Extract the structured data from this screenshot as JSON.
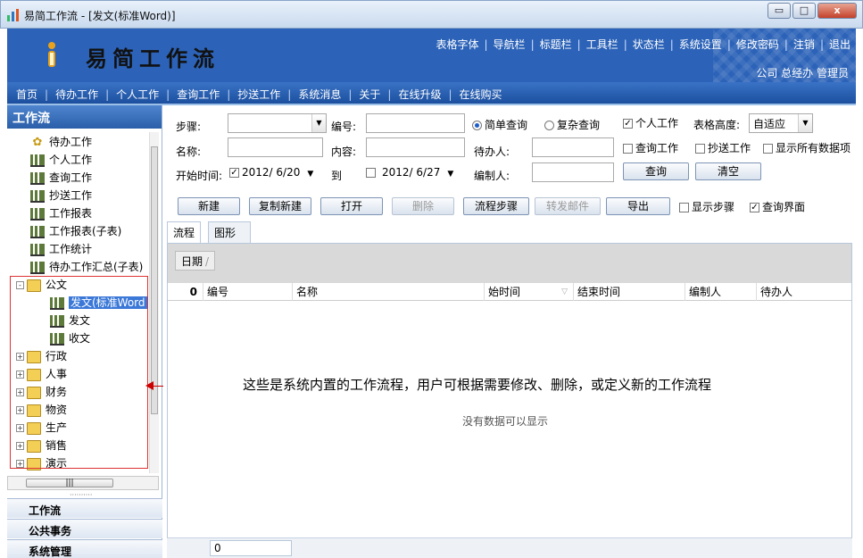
{
  "window": {
    "title": "易简工作流 - [发文(标准Word)]",
    "minimize": "▭",
    "maximize": "□",
    "close": "x"
  },
  "banner": {
    "app_title": "易简工作流",
    "links": [
      "表格字体",
      "导航栏",
      "标题栏",
      "工具栏",
      "状态栏",
      "系统设置",
      "修改密码",
      "注销",
      "退出"
    ],
    "user_info": "公司 总经办 管理员"
  },
  "nav": [
    "首页",
    "待办工作",
    "个人工作",
    "查询工作",
    "抄送工作",
    "系统消息",
    "关于",
    "在线升级",
    "在线购买"
  ],
  "sidebar": {
    "header": "工作流",
    "tree": [
      {
        "label": "待办工作"
      },
      {
        "label": "个人工作"
      },
      {
        "label": "查询工作"
      },
      {
        "label": "抄送工作"
      },
      {
        "label": "工作报表"
      },
      {
        "label": "工作报表(子表)"
      },
      {
        "label": "工作统计"
      },
      {
        "label": "待办工作汇总(子表)"
      },
      {
        "label": "公文",
        "expander": "-"
      },
      {
        "label": "发文(标准Word"
      },
      {
        "label": "发文"
      },
      {
        "label": "收文"
      },
      {
        "label": "行政",
        "expander": "+"
      },
      {
        "label": "人事",
        "expander": "+"
      },
      {
        "label": "财务",
        "expander": "+"
      },
      {
        "label": "物资",
        "expander": "+"
      },
      {
        "label": "生产",
        "expander": "+"
      },
      {
        "label": "销售",
        "expander": "+"
      },
      {
        "label": "演示",
        "expander": "+"
      }
    ],
    "hscroll_grip": "|||",
    "resize_grip": "··········",
    "accordion": [
      "工作流",
      "公共事务",
      "系统管理"
    ]
  },
  "form": {
    "step_label": "步骤:",
    "step_value": "",
    "number_label": "编号:",
    "number_value": "",
    "name_label": "名称:",
    "name_value": "",
    "content_label": "内容:",
    "content_value": "",
    "simple_query": "简单查询",
    "complex_query": "复杂查询",
    "personal_work": "个人工作",
    "table_height_label": "表格高度:",
    "table_height_value": "自适应",
    "pending_person_label": "待办人:",
    "pending_person_value": "",
    "query_work": "查询工作",
    "cc_work": "抄送工作",
    "show_all_data": "显示所有数据项",
    "start_time_label": "开始时间:",
    "start_date": "2012/ 6/20",
    "to_label": "到",
    "end_date": "2012/ 6/27",
    "editor_label": "编制人:",
    "editor_value": "",
    "query_button": "查询",
    "clear_button": "清空"
  },
  "toolbar": {
    "new": "新建",
    "copy_new": "复制新建",
    "open": "打开",
    "delete": "删除",
    "flow_steps": "流程步骤",
    "forward_mail": "转发邮件",
    "export": "导出",
    "show_steps": "显示步骤",
    "query_ui": "查询界面"
  },
  "tabs": [
    "流程",
    "图形"
  ],
  "grid": {
    "group_tag": "日期",
    "columns": [
      "0",
      "编号",
      "名称",
      "始时间",
      "结束时间",
      "编制人",
      "待办人"
    ],
    "empty_text": "没有数据可以显示",
    "footer_value": "0"
  },
  "annotation": "这些是系统内置的工作流程，用户可根据需要修改、删除，或定义新的工作流程"
}
